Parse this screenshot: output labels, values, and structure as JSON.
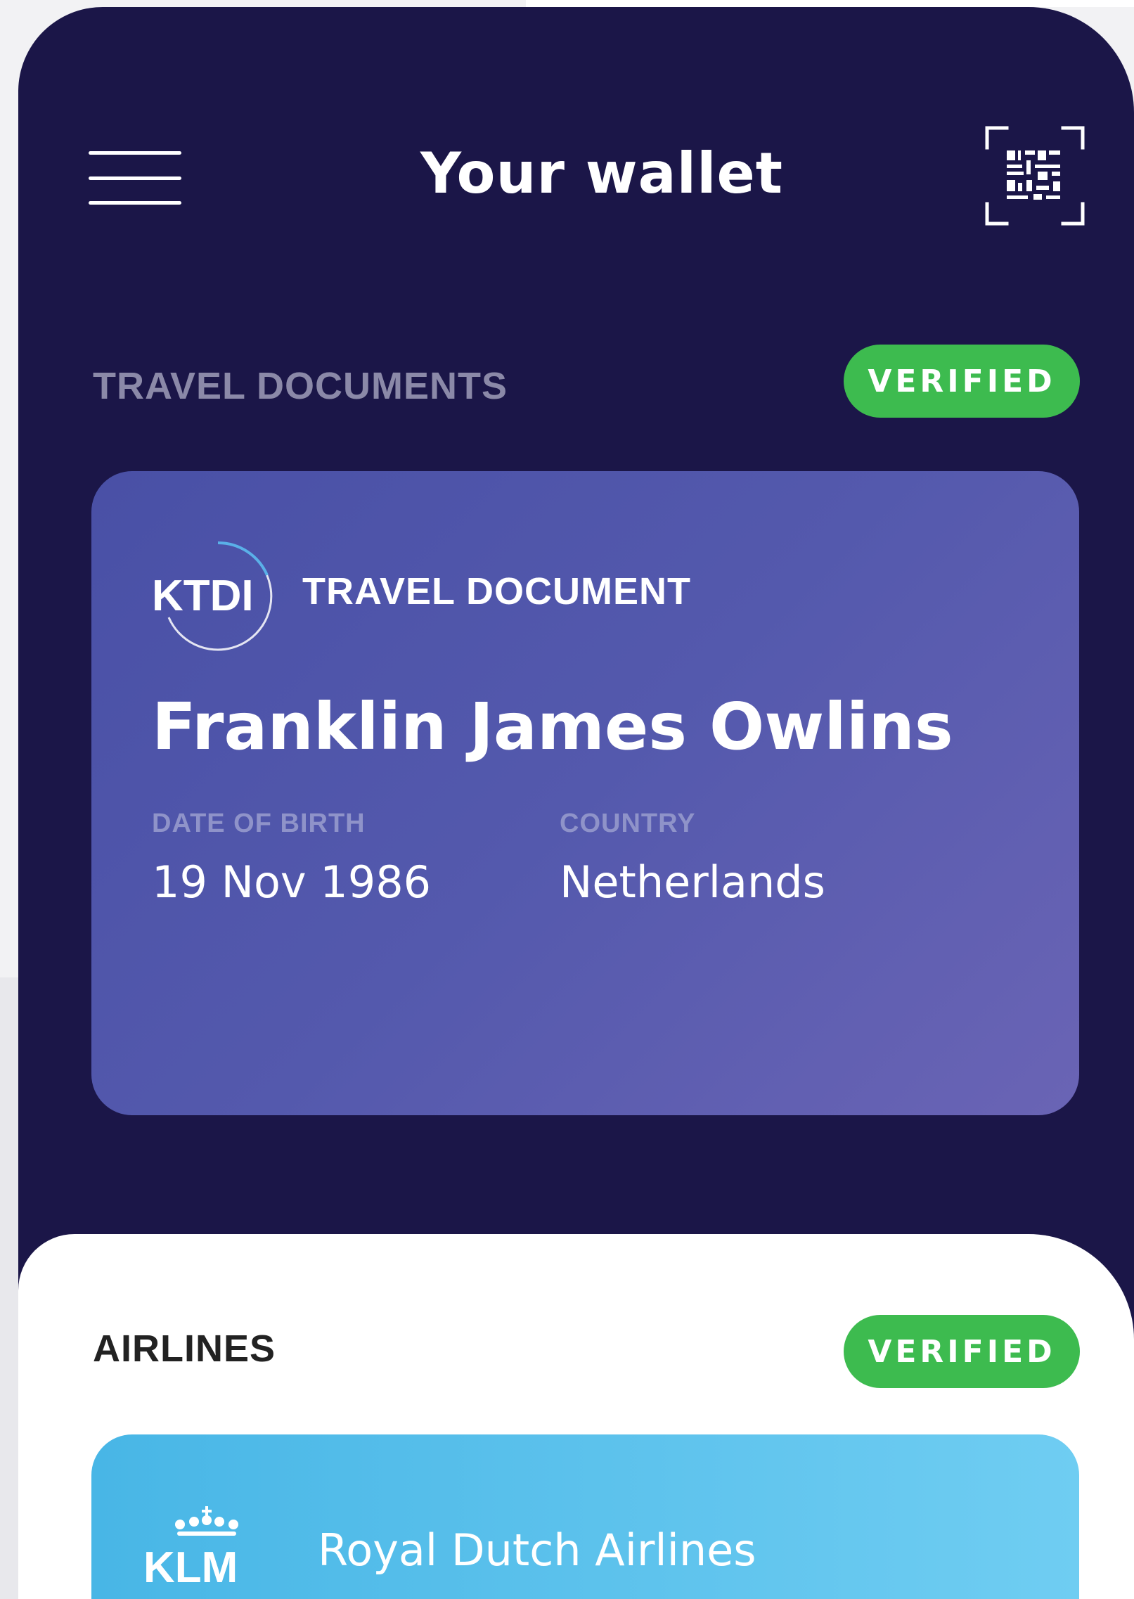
{
  "header": {
    "title": "Your wallet",
    "menu_icon": "hamburger-menu-icon",
    "scan_icon": "qr-scan-icon"
  },
  "travel_section": {
    "label": "TRAVEL DOCUMENTS",
    "badge": "VERIFIED",
    "card": {
      "logo_text": "KTDI",
      "type": "TRAVEL DOCUMENT",
      "holder_name": "Franklin James Owlins",
      "dob_label": "DATE OF BIRTH",
      "dob_value": "19 Nov 1986",
      "country_label": "COUNTRY",
      "country_value": "Netherlands"
    }
  },
  "airlines_section": {
    "label": "AIRLINES",
    "badge": "VERIFIED",
    "card": {
      "logo_text": "KLM",
      "name": "Royal Dutch Airlines"
    }
  },
  "colors": {
    "background": "#1b1648",
    "travel_card": "#5057aa",
    "verified_badge": "#3dbb4f",
    "airline_card": "#5cc2ee"
  }
}
